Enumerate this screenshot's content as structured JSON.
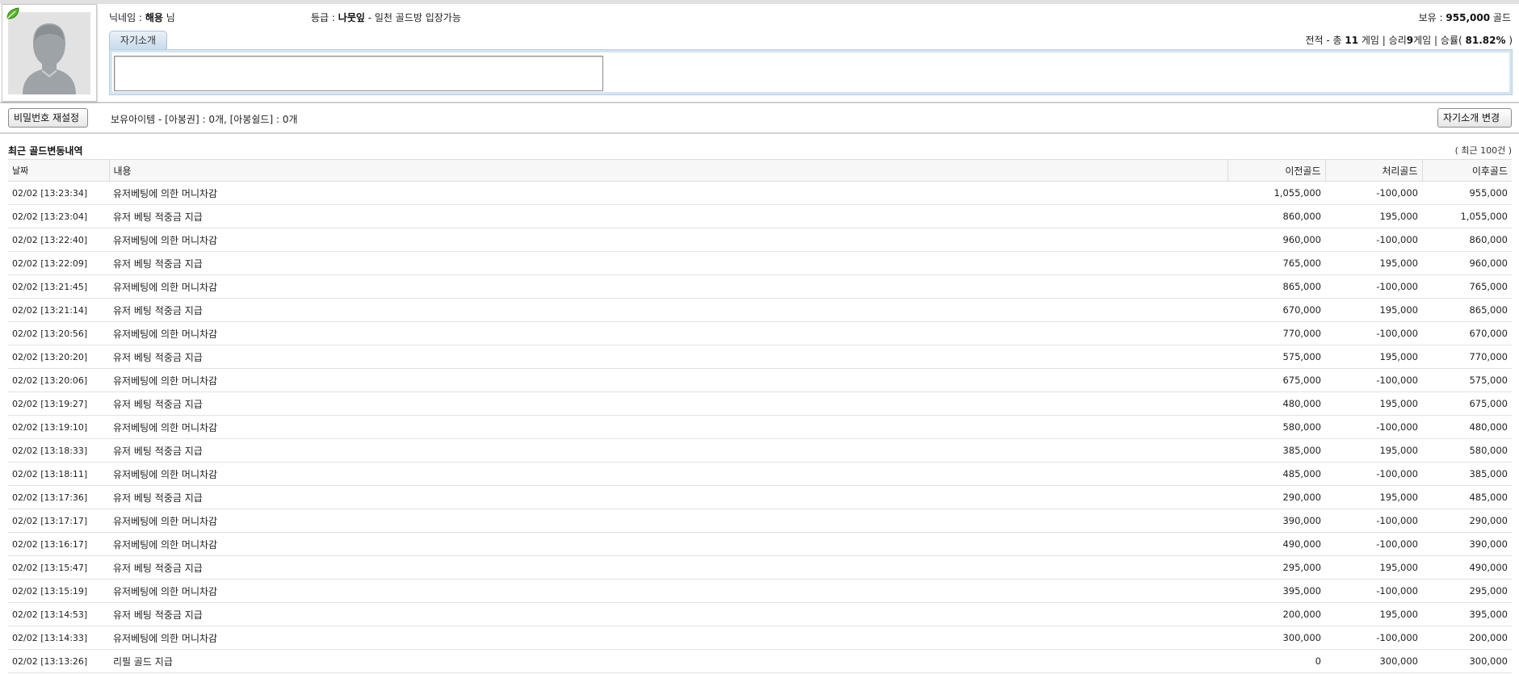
{
  "profile": {
    "nickname_label": "닉네임 :",
    "nickname": "해용",
    "nickname_suffix": "님",
    "grade_label": "등급 :",
    "grade": "나뭇잎",
    "grade_desc": "- 일천 골드방 입장가능",
    "hold_label": "보유 :",
    "hold_amount": "955,000",
    "hold_unit": "골드",
    "intro_tab": "자기소개",
    "intro_text": "",
    "record_prefix": "전적 - 총",
    "record_games": "11",
    "record_games_unit": "게임 |",
    "record_wins_label": "승리",
    "record_wins": "9",
    "record_wins_unit": "게임 |",
    "record_rate_label": "승률(",
    "record_rate": "81.82%",
    "record_rate_suffix": ")"
  },
  "actions": {
    "reset_password": "비밀번호 재설정",
    "items_text": "보유아이템 - [아봉권] : 0개, [아봉쉴드] : 0개",
    "change_intro": "자기소개 변경"
  },
  "history": {
    "title": "최근 골드변동내역",
    "count": "( 최근 100건 )",
    "columns": [
      "날짜",
      "내용",
      "이전골드",
      "처리골드",
      "이후골드"
    ],
    "rows": [
      [
        "02/02 [13:23:34]",
        "유저베팅에 의한 머니차감",
        "1,055,000",
        "-100,000",
        "955,000"
      ],
      [
        "02/02 [13:23:04]",
        "유저 베팅 적중금 지급",
        "860,000",
        "195,000",
        "1,055,000"
      ],
      [
        "02/02 [13:22:40]",
        "유저베팅에 의한 머니차감",
        "960,000",
        "-100,000",
        "860,000"
      ],
      [
        "02/02 [13:22:09]",
        "유저 베팅 적중금 지급",
        "765,000",
        "195,000",
        "960,000"
      ],
      [
        "02/02 [13:21:45]",
        "유저베팅에 의한 머니차감",
        "865,000",
        "-100,000",
        "765,000"
      ],
      [
        "02/02 [13:21:14]",
        "유저 베팅 적중금 지급",
        "670,000",
        "195,000",
        "865,000"
      ],
      [
        "02/02 [13:20:56]",
        "유저베팅에 의한 머니차감",
        "770,000",
        "-100,000",
        "670,000"
      ],
      [
        "02/02 [13:20:20]",
        "유저 베팅 적중금 지급",
        "575,000",
        "195,000",
        "770,000"
      ],
      [
        "02/02 [13:20:06]",
        "유저베팅에 의한 머니차감",
        "675,000",
        "-100,000",
        "575,000"
      ],
      [
        "02/02 [13:19:27]",
        "유저 베팅 적중금 지급",
        "480,000",
        "195,000",
        "675,000"
      ],
      [
        "02/02 [13:19:10]",
        "유저베팅에 의한 머니차감",
        "580,000",
        "-100,000",
        "480,000"
      ],
      [
        "02/02 [13:18:33]",
        "유저 베팅 적중금 지급",
        "385,000",
        "195,000",
        "580,000"
      ],
      [
        "02/02 [13:18:11]",
        "유저베팅에 의한 머니차감",
        "485,000",
        "-100,000",
        "385,000"
      ],
      [
        "02/02 [13:17:36]",
        "유저 베팅 적중금 지급",
        "290,000",
        "195,000",
        "485,000"
      ],
      [
        "02/02 [13:17:17]",
        "유저베팅에 의한 머니차감",
        "390,000",
        "-100,000",
        "290,000"
      ],
      [
        "02/02 [13:16:17]",
        "유저베팅에 의한 머니차감",
        "490,000",
        "-100,000",
        "390,000"
      ],
      [
        "02/02 [13:15:47]",
        "유저 베팅 적중금 지급",
        "295,000",
        "195,000",
        "490,000"
      ],
      [
        "02/02 [13:15:19]",
        "유저베팅에 의한 머니차감",
        "395,000",
        "-100,000",
        "295,000"
      ],
      [
        "02/02 [13:14:53]",
        "유저 베팅 적중금 지급",
        "200,000",
        "195,000",
        "395,000"
      ],
      [
        "02/02 [13:14:33]",
        "유저베팅에 의한 머니차감",
        "300,000",
        "-100,000",
        "200,000"
      ],
      [
        "02/02 [13:13:26]",
        "리필 골드 지급",
        "0",
        "300,000",
        "300,000"
      ]
    ]
  },
  "icons": {
    "avatar": "user-silhouette-icon",
    "grade_badge": "leaf-icon"
  },
  "colors": {
    "tab_bg": "#c9dbec",
    "intro_frame": "#d4e4f2",
    "avatar_bg": "#e2e2e2",
    "leaf": "#5cb82a"
  }
}
